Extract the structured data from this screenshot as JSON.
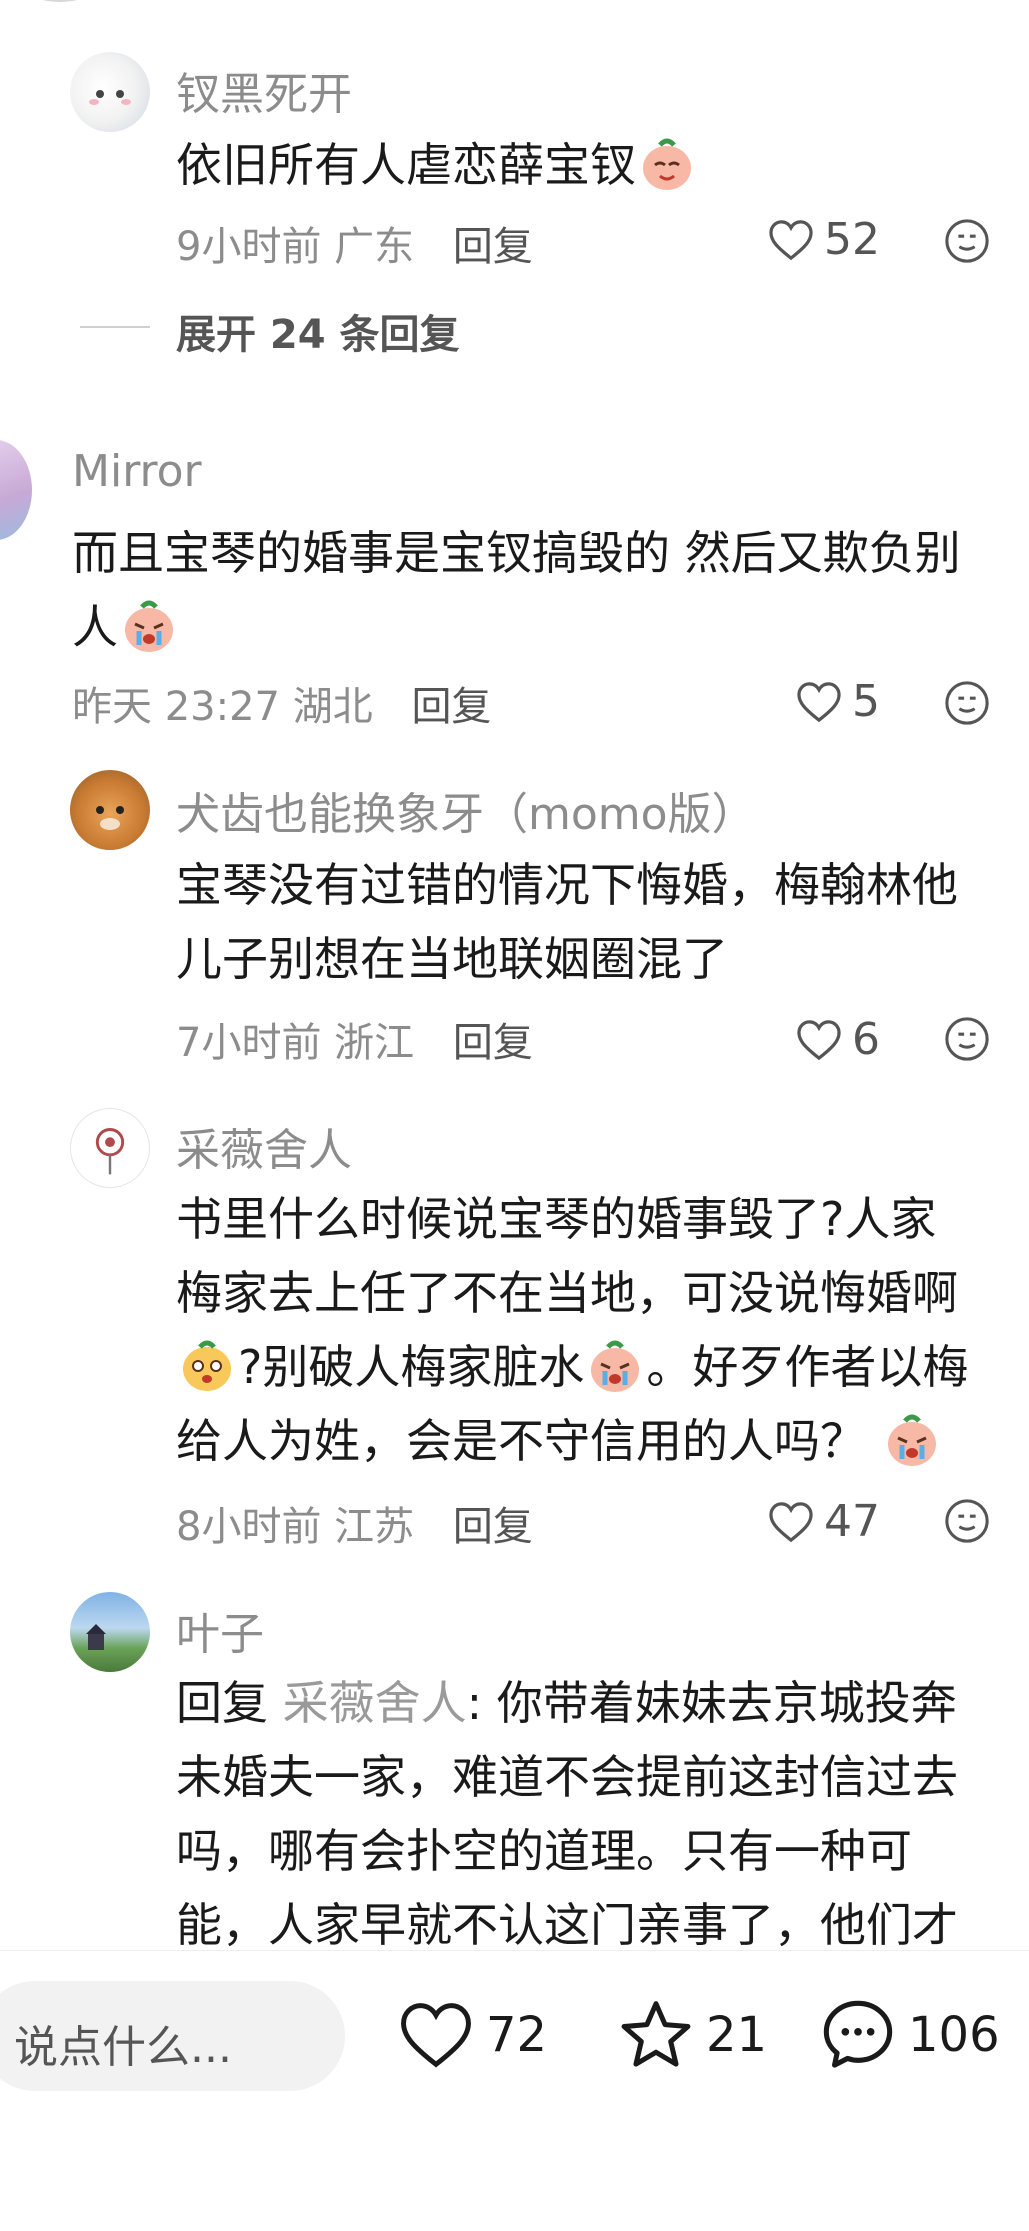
{
  "comments": [
    {
      "username": "钗黑死开",
      "text": "依旧所有人虐恋薛宝钗",
      "time": "9小时前",
      "location": "广东",
      "reply_label": "回复",
      "likes": "52",
      "expand_label": "展开 24 条回复"
    },
    {
      "username": "Mirror",
      "text_line1": "而且宝琴的婚事是宝钗搞毁的 然后又欺负别",
      "text_line2": "人",
      "time": "昨天 23:27",
      "location": "湖北",
      "reply_label": "回复",
      "likes": "5"
    },
    {
      "username": "犬齿也能换象牙（momo版）",
      "text_line1": "宝琴没有过错的情况下悔婚，梅翰林他",
      "text_line2": "儿子别想在当地联姻圈混了",
      "time": "7小时前",
      "location": "浙江",
      "reply_label": "回复",
      "likes": "6"
    },
    {
      "username": "采薇舍人",
      "text_line1": "书里什么时候说宝琴的婚事毁了?人家",
      "text_line2": "梅家去上任了不在当地，可没说悔婚啊",
      "text_line3a": "?别破人梅家脏水",
      "text_line3b": "。好歹作者以梅",
      "text_line4": "给人为姓，会是不守信用的人吗？",
      "time": "8小时前",
      "location": "江苏",
      "reply_label": "回复",
      "likes": "47"
    },
    {
      "username": "叶子",
      "reply_prefix": "回复",
      "reply_to": "采薇舍人",
      "text_line1": ": 你带着妹妹去京城投奔",
      "text_line2": "未婚夫一家，难道不会提前这封信过去",
      "text_line3": "吗，哪有会扑空的道理。只有一种可",
      "text_line4": "能，人家早就不认这门亲事了，他们才"
    }
  ],
  "bottom_bar": {
    "input_placeholder": "说点什么...",
    "likes": "72",
    "favorites": "21",
    "comments": "106"
  },
  "icons": [
    "heart-icon",
    "emoji-face-icon",
    "star-icon",
    "chat-bubble-icon",
    "crying-emoji-icon",
    "smiling-emoji-icon",
    "surprised-emoji-icon"
  ]
}
